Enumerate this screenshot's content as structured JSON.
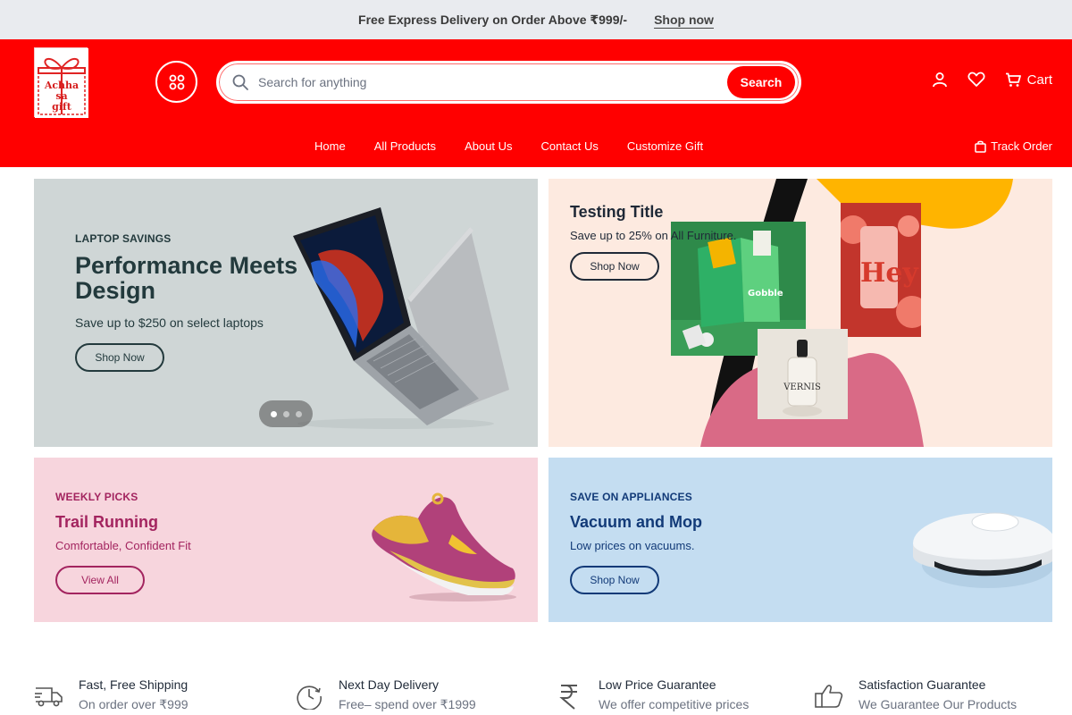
{
  "topbar": {
    "message": "Free Express Delivery on Order Above ₹999/-",
    "link": "Shop now"
  },
  "header": {
    "logo_text": [
      "Achha",
      "sa",
      "gift"
    ],
    "search_placeholder": "Search for anything",
    "search_button": "Search",
    "cart_label": "Cart",
    "nav": [
      "Home",
      "All Products",
      "About Us",
      "Contact Us",
      "Customize Gift"
    ],
    "track_order": "Track Order",
    "colors": {
      "brand": "#ff0000"
    }
  },
  "banners": {
    "laptop": {
      "kicker": "LAPTOP SAVINGS",
      "title": "Performance Meets Design",
      "subtitle": "Save up to $250 on select laptops",
      "button": "Shop Now",
      "slides": 3,
      "active_slide": 1
    },
    "testing": {
      "title": "Testing Title",
      "subtitle": "Save up to 25% on All Furniture.",
      "button": "Shop Now",
      "image_texts": {
        "box": "Gobble",
        "can": "Hey",
        "bottle": "VERNIS"
      }
    },
    "running": {
      "kicker": "WEEKLY PICKS",
      "title": "Trail Running",
      "subtitle": "Comfortable, Confident Fit",
      "button": "View All"
    },
    "appliances": {
      "kicker": "SAVE ON APPLIANCES",
      "title": "Vacuum and Mop",
      "subtitle": "Low prices on vacuums.",
      "button": "Shop Now"
    }
  },
  "features": [
    {
      "icon": "truck-icon",
      "title": "Fast, Free Shipping",
      "subtitle": "On order over ₹999"
    },
    {
      "icon": "clock-icon",
      "title": "Next Day Delivery",
      "subtitle": "Free– spend over ₹1999"
    },
    {
      "icon": "rupee-icon",
      "title": "Low Price Guarantee",
      "subtitle": "We offer competitive prices"
    },
    {
      "icon": "thumbs-up-icon",
      "title": "Satisfaction Guarantee",
      "subtitle": "We Guarantee Our Products"
    }
  ]
}
